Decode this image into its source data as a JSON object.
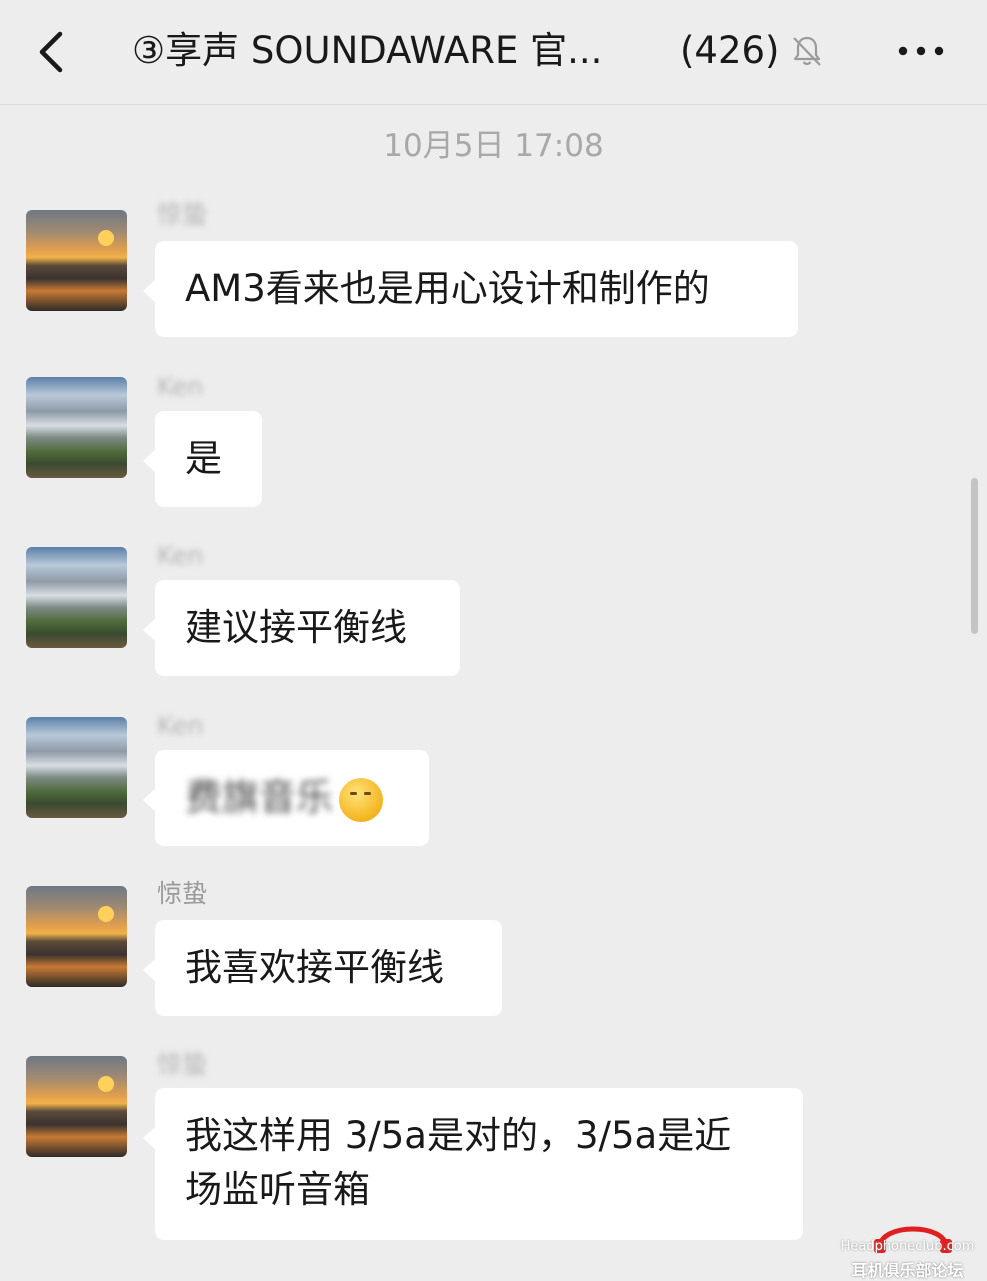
{
  "header": {
    "title": "③享声 SOUNDAWARE 官...",
    "member_count": "(426)",
    "icons": {
      "back": "chevron-left-icon",
      "mute": "bell-muted-icon",
      "more": "more-dots-icon"
    }
  },
  "timestamp": "10月5日 17:08",
  "messages": [
    {
      "sender": "惊蛰",
      "text": "AM3看来也是用心设计和制作的",
      "avatar": "sunset"
    },
    {
      "sender": "Ken",
      "text": "是",
      "avatar": "sky"
    },
    {
      "sender": "Ken",
      "text": "建议接平衡线",
      "avatar": "sky"
    },
    {
      "sender": "Ken",
      "text": "费旗音乐",
      "emoji": "thinking-face-icon",
      "avatar": "sky"
    },
    {
      "sender": "惊蛰",
      "text": "我喜欢接平衡线",
      "avatar": "sunset"
    },
    {
      "sender": "惊蛰",
      "text_line1": "我这样用 3/5a是对的，3/5a是近",
      "text_line2": "场监听音箱",
      "avatar": "sunset"
    }
  ],
  "watermark": {
    "url": "Headphoneclub.com",
    "cn": "耳机俱乐部论坛"
  }
}
